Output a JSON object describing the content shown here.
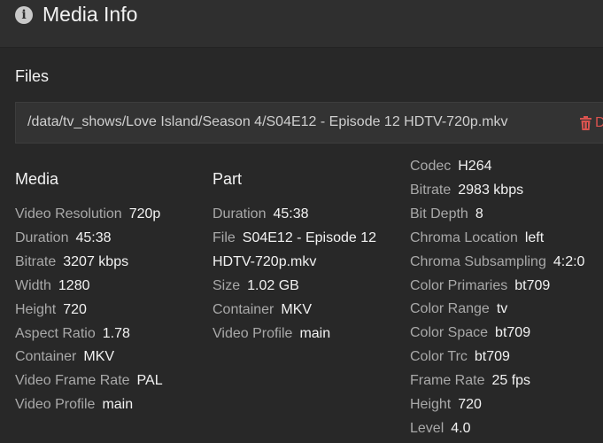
{
  "window": {
    "title": "Media Info"
  },
  "files": {
    "heading": "Files",
    "path": "/data/tv_shows/Love Island/Season 4/S04E12 - Episode 12 HDTV-720p.mkv",
    "delete_label": "D"
  },
  "media": {
    "heading": "Media",
    "items": [
      {
        "k": "Video Resolution",
        "v": "720p"
      },
      {
        "k": "Duration",
        "v": "45:38"
      },
      {
        "k": "Bitrate",
        "v": "3207 kbps"
      },
      {
        "k": "Width",
        "v": "1280"
      },
      {
        "k": "Height",
        "v": "720"
      },
      {
        "k": "Aspect Ratio",
        "v": "1.78"
      },
      {
        "k": "Container",
        "v": "MKV"
      },
      {
        "k": "Video Frame Rate",
        "v": "PAL"
      },
      {
        "k": "Video Profile",
        "v": "main"
      }
    ]
  },
  "part": {
    "heading": "Part",
    "duration": {
      "k": "Duration",
      "v": "45:38"
    },
    "file": {
      "k": "File",
      "v": "S04E12 - Episode 12",
      "v2": "HDTV-720p.mkv"
    },
    "size": {
      "k": "Size",
      "v": "1.02 GB"
    },
    "container": {
      "k": "Container",
      "v": "MKV"
    },
    "profile": {
      "k": "Video Profile",
      "v": "main"
    }
  },
  "stream": {
    "items": [
      {
        "k": "Codec",
        "v": "H264"
      },
      {
        "k": "Bitrate",
        "v": "2983 kbps"
      },
      {
        "k": "Bit Depth",
        "v": "8"
      },
      {
        "k": "Chroma Location",
        "v": "left"
      },
      {
        "k": "Chroma Subsampling",
        "v": "4:2:0"
      },
      {
        "k": "Color Primaries",
        "v": "bt709"
      },
      {
        "k": "Color Range",
        "v": "tv"
      },
      {
        "k": "Color Space",
        "v": "bt709"
      },
      {
        "k": "Color Trc",
        "v": "bt709"
      },
      {
        "k": "Frame Rate",
        "v": "25 fps"
      },
      {
        "k": "Height",
        "v": "720"
      },
      {
        "k": "Level",
        "v": "4.0"
      }
    ]
  },
  "colors": {
    "delete": "#d9534f",
    "label": "#a9a9a9",
    "value": "#f2f2f2"
  }
}
